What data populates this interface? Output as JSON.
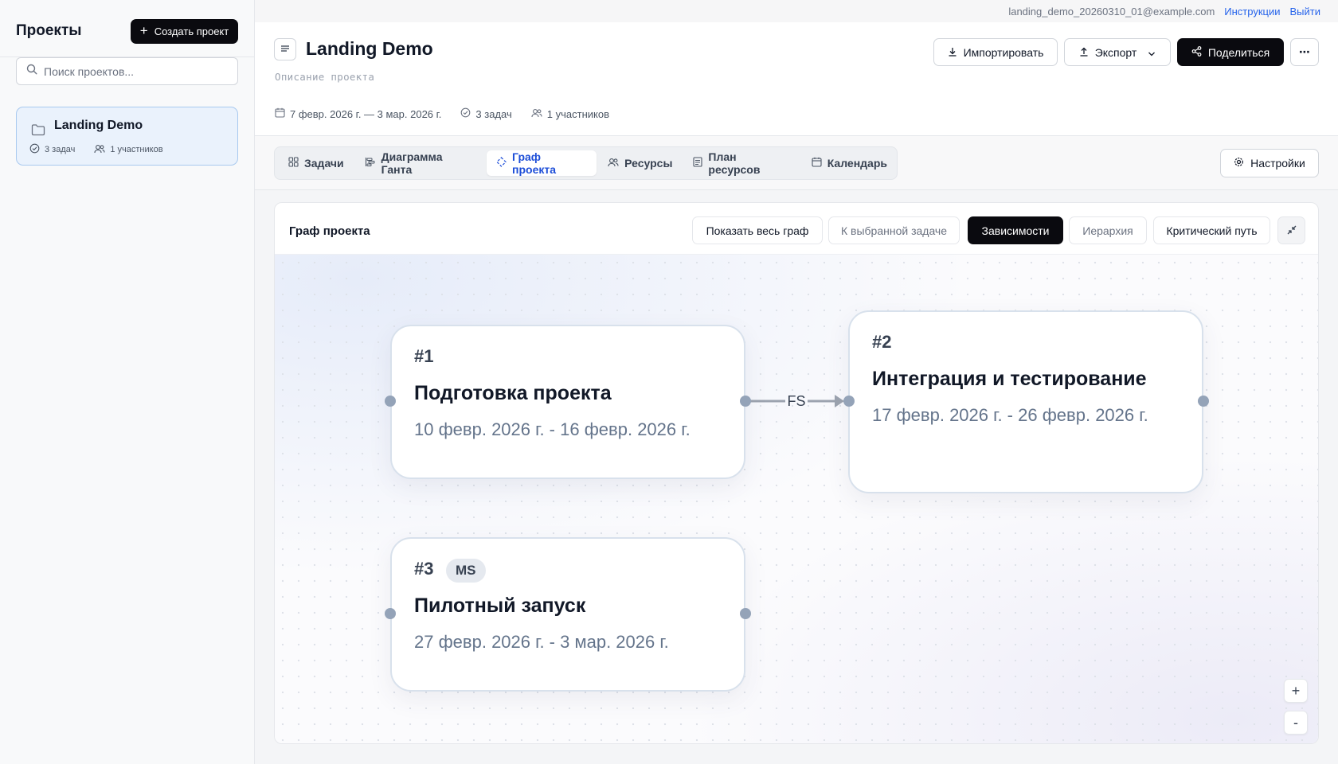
{
  "sidebar": {
    "title": "Проекты",
    "create_label": "Создать проект",
    "search_placeholder": "Поиск проектов...",
    "projects": [
      {
        "name": "Landing Demo",
        "tasks": "3 задач",
        "members": "1 участников"
      }
    ]
  },
  "topbar": {
    "email": "landing_demo_20260310_01@example.com",
    "instructions": "Инструкции",
    "logout": "Выйти"
  },
  "header": {
    "title": "Landing Demo",
    "description_placeholder": "Описание проекта",
    "date_range": "7 февр. 2026 г. — 3 мар. 2026 г.",
    "tasks": "3 задач",
    "members": "1 участников",
    "import_label": "Импортировать",
    "export_label": "Экспорт",
    "share_label": "Поделиться",
    "more_label": "⋯"
  },
  "tabs": [
    {
      "label": "Задачи",
      "icon": "grid-icon",
      "active": false
    },
    {
      "label": "Диаграмма Ганта",
      "icon": "gantt-icon",
      "active": false
    },
    {
      "label": "Граф проекта",
      "icon": "graph-icon",
      "active": true
    },
    {
      "label": "Ресурсы",
      "icon": "users-icon",
      "active": false
    },
    {
      "label": "План ресурсов",
      "icon": "plan-icon",
      "active": false
    },
    {
      "label": "Календарь",
      "icon": "calendar-icon",
      "active": false
    }
  ],
  "settings_label": "Настройки",
  "graph": {
    "title": "Граф проекта",
    "buttons": {
      "show_all": "Показать весь граф",
      "to_selected": "К выбранной задаче",
      "dependencies": "Зависимости",
      "hierarchy": "Иерархия",
      "critical_path": "Критический путь"
    },
    "nodes": [
      {
        "num": "#1",
        "title": "Подготовка проекта",
        "dates": "10 февр. 2026 г. - 16 февр. 2026 г."
      },
      {
        "num": "#2",
        "title": "Интеграция и тестирование",
        "dates": "17 февр. 2026 г. - 26 февр. 2026 г."
      },
      {
        "num": "#3",
        "badge": "MS",
        "title": "Пилотный запуск",
        "dates": "27 февр. 2026 г. - 3 мар. 2026 г."
      }
    ],
    "edges": [
      {
        "from": "#1",
        "to": "#2",
        "label": "FS"
      }
    ],
    "zoom_in": "+",
    "zoom_out": "-"
  }
}
